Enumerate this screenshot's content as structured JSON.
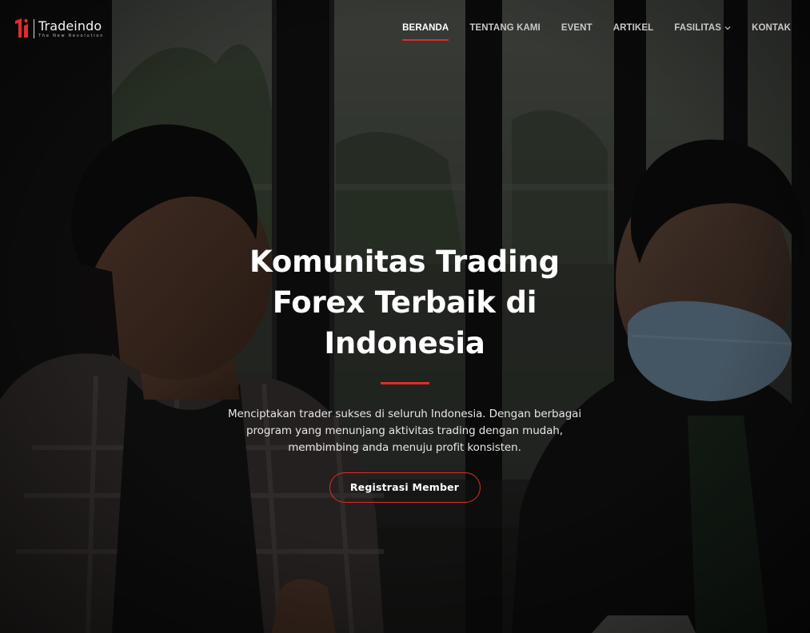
{
  "brand": {
    "name": "Tradeindo",
    "tagline": "The New Revolution",
    "accent_color": "#e12b2b",
    "logo_icon": "tradeindo-logo-icon"
  },
  "nav": {
    "items": [
      {
        "label": "BERANDA",
        "active": true
      },
      {
        "label": "TENTANG KAMI",
        "active": false
      },
      {
        "label": "EVENT",
        "active": false
      },
      {
        "label": "ARTIKEL",
        "active": false
      },
      {
        "label": "FASILITAS",
        "active": false,
        "dropdown": true,
        "icon": "chevron-down-icon"
      },
      {
        "label": "KONTAK",
        "active": false
      }
    ]
  },
  "hero": {
    "title_lines": [
      "Komunitas Trading",
      "Forex Terbaik di",
      "Indonesia"
    ],
    "description_lines": [
      "Menciptakan trader sukses di seluruh Indonesia. Dengan berbagai",
      "program yang menunjang aktivitas trading dengan mudah,",
      "membimbing anda menuju profit konsisten."
    ],
    "cta_label": "Registrasi Member",
    "background_image": "two young men talking at a table in front of a large window"
  }
}
